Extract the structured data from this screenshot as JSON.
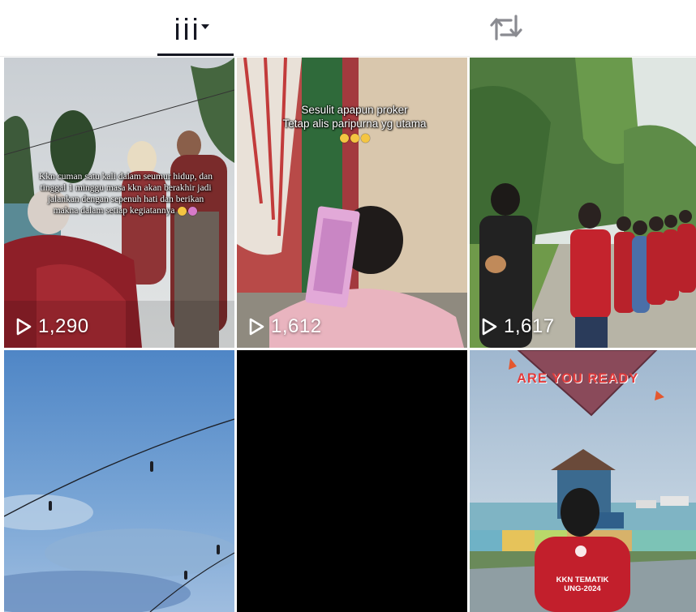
{
  "tabs": [
    {
      "id": "videos",
      "icon": "grid-icon",
      "has_dropdown": true,
      "active": true
    },
    {
      "id": "reposts",
      "icon": "repost-icon",
      "active": false
    }
  ],
  "videos": [
    {
      "views": "1,290",
      "caption": "Kkn cuman satu kali dalam seumur hidup, dan tinggal 1 minggu masa kkn akan berakhir jadi jalankan dengan sepenuh hati dan berikan makna dalam setiap kegiatannya"
    },
    {
      "views": "1,612",
      "caption_line1": "Sesulit apapun proker",
      "caption_line2": "Tetap alis paripurna yg utama"
    },
    {
      "views": "1,617"
    },
    {
      "views": ""
    },
    {
      "views": ""
    },
    {
      "views": "",
      "overlay_title": "ARE YOU READY",
      "shirt_line1": "KKN TEMATIK",
      "shirt_line2": "UNG-2024"
    }
  ],
  "colors": {
    "tab_active": "#161823",
    "tab_inactive": "#8a8b91"
  }
}
